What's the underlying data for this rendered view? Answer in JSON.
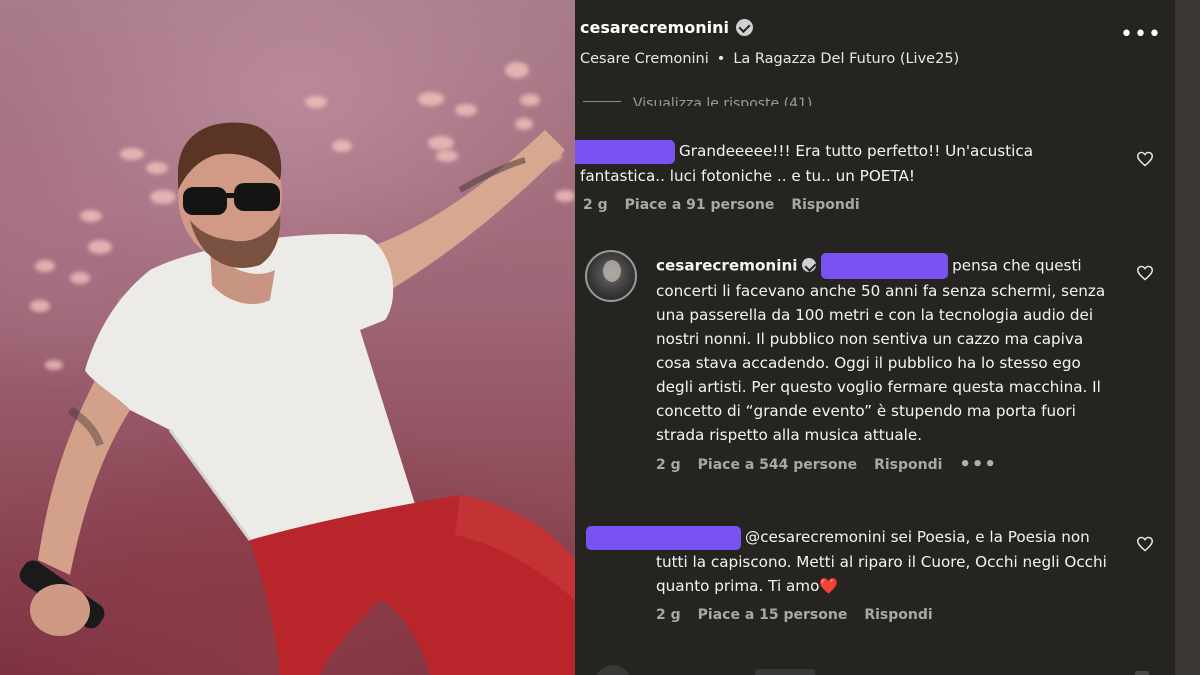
{
  "post_header": {
    "username": "cesarecremonini",
    "subtitle_name": "Cesare Cremonini",
    "separator": "•",
    "song": "La Ragazza Del Futuro (Live25)"
  },
  "view_replies": "Visualizza le risposte (41)",
  "comments": [
    {
      "username": "",
      "text": "Grandeeeee!!! Era tutto perfetto!! Un'acustica fantastica.. luci fotoniche .. e tu.. un POETA!",
      "time": "2 g",
      "likes": "Piace a 91 persone",
      "reply": "Rispondi"
    },
    {
      "username": "cesarecremonini",
      "text": "pensa che questi concerti li facevano anche 50 anni fa senza schermi, senza una passerella da 100 metri e con la tecnologia audio dei nostri nonni. Il pubblico non sentiva un cazzo ma capiva cosa stava accadendo. Oggi il pubblico ha lo stesso ego degli artisti. Per questo voglio fermare questa macchina. Il concetto di “grande evento” è stupendo ma porta fuori strada rispetto alla musica attuale.",
      "time": "2 g",
      "likes": "Piace a 544 persone",
      "reply": "Rispondi",
      "more": "•••"
    },
    {
      "username": "",
      "text": "@cesarecremonini sei Poesia, e la Poesia non tutti la capiscono. Metti al riparo il Cuore, Occhi negli Occhi quanto prima. Ti amo",
      "emoji": "❤️",
      "time": "2 g",
      "likes": "Piace a 15 persone",
      "reply": "Rispondi"
    }
  ],
  "icons": {
    "more": "more-horizontal-icon",
    "like": "heart-outline-icon",
    "verified": "verified-badge-icon"
  },
  "colors": {
    "panel_bg": "#262420",
    "redaction": "#7b52f2",
    "meta_text": "#a8a8a8"
  }
}
